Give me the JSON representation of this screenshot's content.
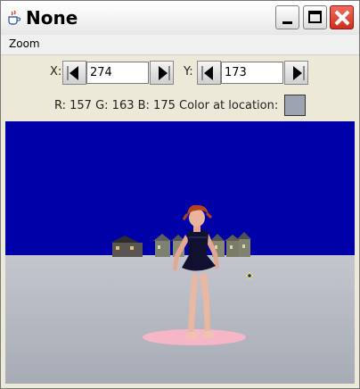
{
  "window": {
    "title": "None",
    "app_icon": "java-cup-icon",
    "controls": [
      "minimize-icon",
      "maximize-icon",
      "close-icon"
    ]
  },
  "menu": {
    "items": [
      "Zoom"
    ]
  },
  "controls": {
    "x_label": "X:",
    "x_value": "274",
    "y_label": "Y:",
    "y_value": "173",
    "info_text": "R: 157 G: 163 B: 175 Color at location:",
    "sample_color": "#9da3af"
  },
  "scene": {
    "sky_color": "#0000a8",
    "ground_color": "#b2b6c0",
    "platform_color": "#f7b6c8"
  }
}
